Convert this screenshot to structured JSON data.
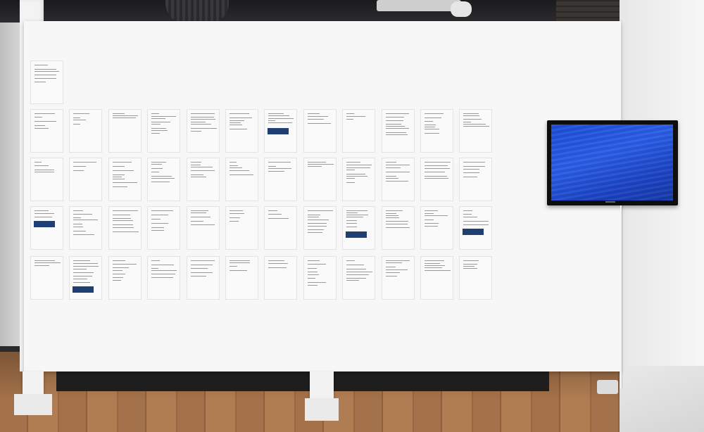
{
  "scene": {
    "subject": "gallery-installation",
    "grid": {
      "rows": 5,
      "columns": 12,
      "top_row_count": 1
    },
    "colors": {
      "wall": "#f7f7f7",
      "floor": "#a4724a",
      "screen": "#2457e0",
      "tv_frame": "#0e0e10"
    }
  }
}
